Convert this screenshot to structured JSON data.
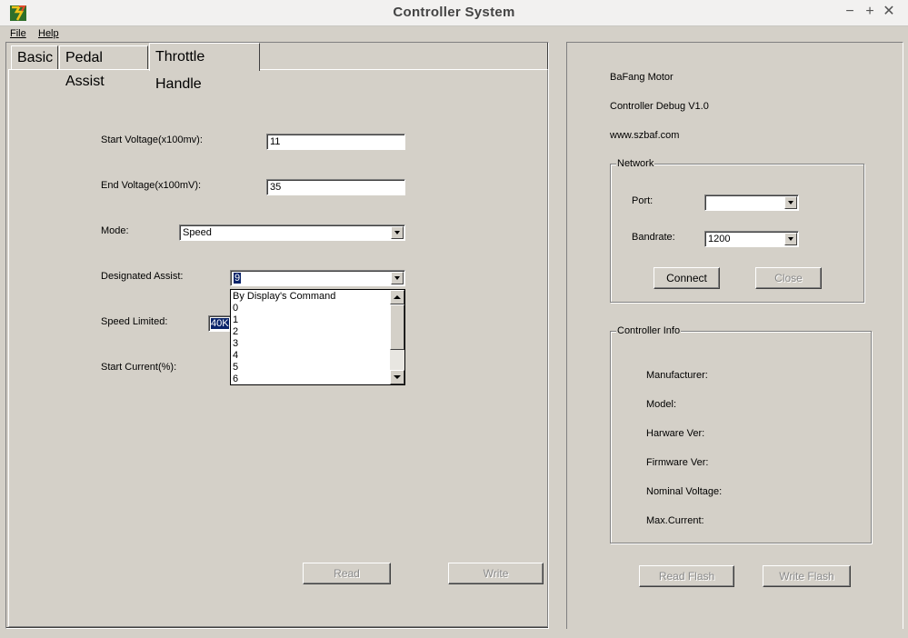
{
  "window": {
    "title": "Controller System",
    "minimize": "−",
    "maximize": "+",
    "close": "✕"
  },
  "menu": {
    "file": "File",
    "help": "Help"
  },
  "tabs": [
    {
      "label": "Basic"
    },
    {
      "label": "Pedal Assist"
    },
    {
      "label": "Throttle Handle",
      "active": true
    }
  ],
  "throttle": {
    "start_voltage": {
      "label": "Start Voltage(x100mv):",
      "value": "11"
    },
    "end_voltage": {
      "label": "End Voltage(x100mV):",
      "value": "35"
    },
    "mode": {
      "label": "Mode:",
      "value": "Speed"
    },
    "designated_assist": {
      "label": "Designated Assist:",
      "value": "9"
    },
    "speed_limited": {
      "label": "Speed Limited:",
      "value": "40K"
    },
    "start_current": {
      "label": "Start Current(%):"
    },
    "dropdown_options": [
      "By Display's Command",
      "0",
      "1",
      "2",
      "3",
      "4",
      "5",
      "6"
    ],
    "read_button": "Read",
    "write_button": "Write"
  },
  "info": {
    "brand": "BaFang Motor",
    "version": "Controller Debug V1.0",
    "website": "www.szbaf.com"
  },
  "network": {
    "title": "Network",
    "port_label": "Port:",
    "port_value": "",
    "bandrate_label": "Bandrate:",
    "bandrate_value": "1200",
    "connect_button": "Connect",
    "close_button": "Close"
  },
  "controller_info": {
    "title": "Controller Info",
    "fields": [
      "Manufacturer:",
      "Model:",
      "Harware Ver:",
      "Firmware Ver:",
      "Nominal Voltage:",
      "Max.Current:"
    ],
    "read_flash_button": "Read Flash",
    "write_flash_button": "Write Flash"
  }
}
